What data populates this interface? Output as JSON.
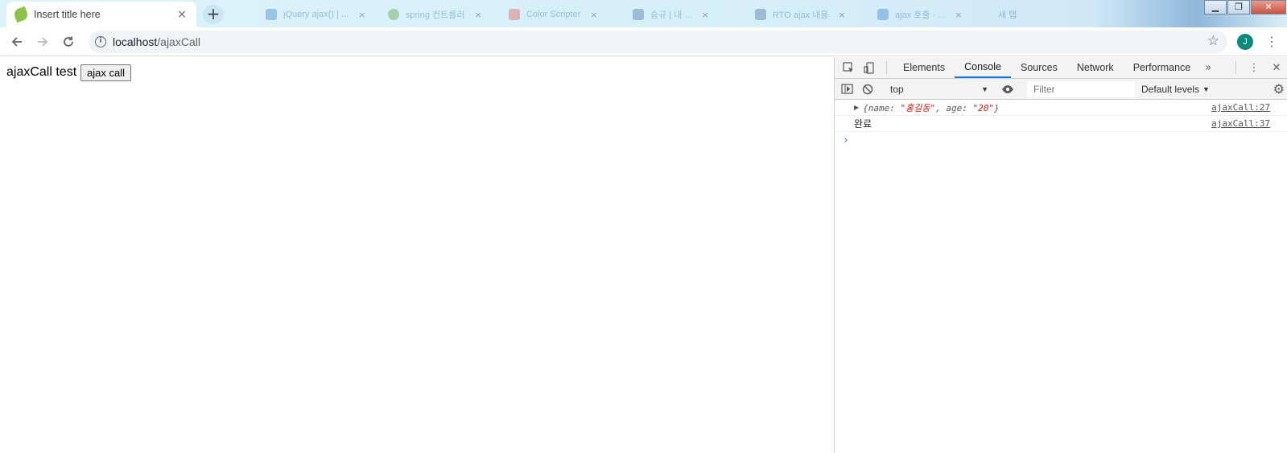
{
  "browser": {
    "active_tab": {
      "title": "Insert title here",
      "close": "×"
    },
    "new_tab": "+",
    "background_tabs": [
      {
        "label": "jQuery ajax() | ..."
      },
      {
        "label": "spring 컨트롤러"
      },
      {
        "label": "Color Scripter"
      },
      {
        "label": "승규 | 내 ..."
      },
      {
        "label": "RTO ajax 내용"
      },
      {
        "label": "ajax 호출 · ..."
      },
      {
        "label": "새 탭"
      }
    ],
    "window_controls": {
      "minimize": "▁",
      "restore": "❐",
      "close": "✕"
    },
    "url_host": "localhost",
    "url_path": "/ajaxCall",
    "avatar_initial": "J",
    "colors": {
      "avatar": "#0b8a7a",
      "accent": "#1a73e8"
    }
  },
  "page": {
    "text": "ajaxCall test",
    "button_label": "ajax call"
  },
  "devtools": {
    "tabs": [
      "Elements",
      "Console",
      "Sources",
      "Network",
      "Performance"
    ],
    "active_tab": "Console",
    "more": "»",
    "context": "top",
    "filter_placeholder": "Filter",
    "levels": "Default levels",
    "logs": [
      {
        "open": "{name: ",
        "name_value": "\"홍길동\"",
        "mid": ", age: ",
        "age_value": "\"20\"",
        "close": "}",
        "source": "ajaxCall:27"
      },
      {
        "text": "완료",
        "source": "ajaxCall:37"
      }
    ],
    "prompt": "›"
  }
}
